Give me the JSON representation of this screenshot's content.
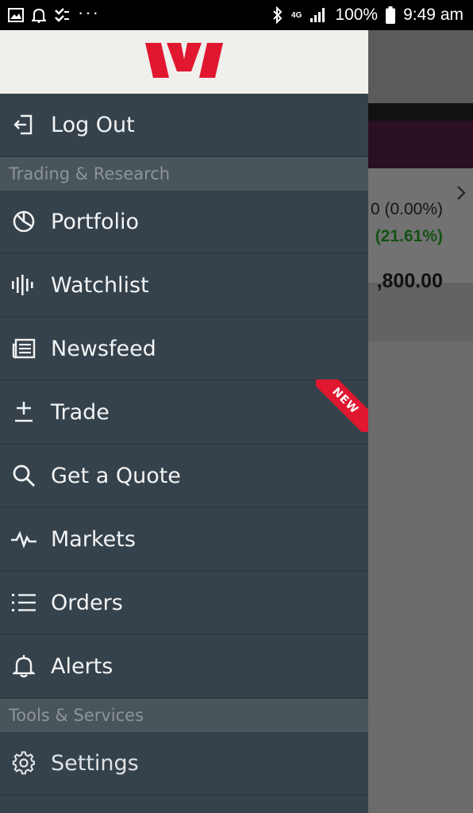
{
  "status_bar": {
    "left_icons": [
      "gallery-icon",
      "notification-bell-icon",
      "checklist-icon",
      "more-dots-icon"
    ],
    "more_dots": "···",
    "network": "4G",
    "battery": "100%",
    "time": "9:49 am"
  },
  "drawer": {
    "brand": {
      "logo": "westpac-logo",
      "color": "#e0172f"
    },
    "logout": {
      "label": "Log Out",
      "icon": "logout-icon"
    },
    "sections": [
      {
        "title": "Trading & Research",
        "items": [
          {
            "label": "Portfolio",
            "icon": "portfolio-pie-icon"
          },
          {
            "label": "Watchlist",
            "icon": "watchlist-bars-icon"
          },
          {
            "label": "Newsfeed",
            "icon": "newspaper-icon"
          },
          {
            "label": "Trade",
            "icon": "plus-minus-icon",
            "badge": "NEW"
          },
          {
            "label": "Get a Quote",
            "icon": "search-icon"
          },
          {
            "label": "Markets",
            "icon": "pulse-line-icon"
          },
          {
            "label": "Orders",
            "icon": "list-icon"
          },
          {
            "label": "Alerts",
            "icon": "bell-icon"
          }
        ]
      },
      {
        "title": "Tools & Services",
        "items": [
          {
            "label": "Settings",
            "icon": "gear-icon"
          }
        ]
      }
    ]
  },
  "background": {
    "change": "0 (0.00%)",
    "change_pct": "(21.61%)",
    "total": ",800.00"
  },
  "colors": {
    "drawer_bg": "#36424b",
    "section_bg": "#4a545b",
    "header_bg": "#efefec",
    "accent_red": "#e0172f",
    "positive_green": "#2e9b2e"
  }
}
